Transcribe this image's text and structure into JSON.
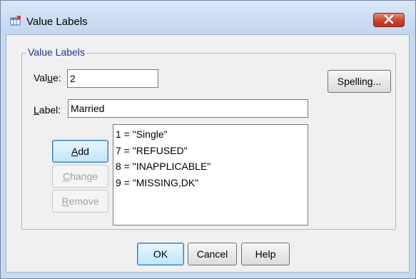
{
  "window": {
    "title": "Value Labels"
  },
  "group": {
    "label": "Value Labels"
  },
  "value_field": {
    "label_pre": "Val",
    "label_mnemonic": "u",
    "label_post": "e:",
    "value": "2"
  },
  "label_field": {
    "label_mnemonic": "L",
    "label_post": "abel:",
    "value": "Married"
  },
  "buttons": {
    "spelling": "Spelling...",
    "add": {
      "mnemonic": "A",
      "rest": "dd"
    },
    "change": {
      "mnemonic": "C",
      "rest": "hange"
    },
    "remove": {
      "mnemonic": "R",
      "rest": "emove"
    },
    "ok": "OK",
    "cancel": "Cancel",
    "help": "Help"
  },
  "value_list": [
    "1 = \"Single\"",
    "7 = \"REFUSED\"",
    "8 = \"INAPPLICABLE\"",
    "9 = \"MISSING,DK\""
  ],
  "icons": {
    "title": "value-labels-app-icon",
    "close": "close-icon"
  }
}
